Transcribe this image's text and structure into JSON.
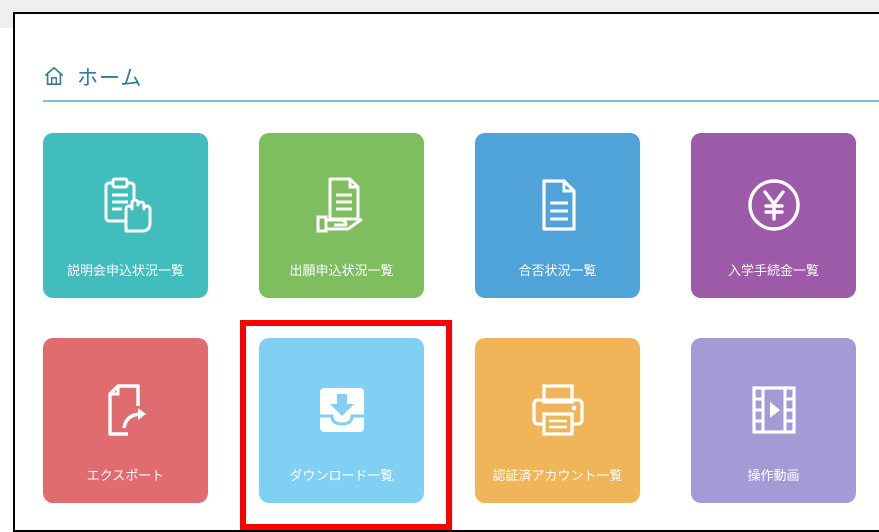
{
  "header": {
    "title": "ホーム",
    "icon": "home-icon"
  },
  "tiles": [
    {
      "label": "説明会申込状況一覧",
      "color": "#41bdbd",
      "icon": "clipboard-hand-icon"
    },
    {
      "label": "出願申込状況一覧",
      "color": "#7fbe5f",
      "icon": "document-hand-icon"
    },
    {
      "label": "合否状況一覧",
      "color": "#4fa3d8",
      "icon": "document-icon"
    },
    {
      "label": "入学手続金一覧",
      "color": "#9c5aa8",
      "icon": "yen-circle-icon"
    },
    {
      "label": "エクスポート",
      "color": "#e06c6f",
      "icon": "export-file-icon"
    },
    {
      "label": "ダウンロード一覧",
      "color": "#80d0f4",
      "icon": "download-tray-icon"
    },
    {
      "label": "認証済アカウント一覧",
      "color": "#f0b558",
      "icon": "printer-icon"
    },
    {
      "label": "操作動画",
      "color": "#a39bd6",
      "icon": "video-film-icon"
    }
  ],
  "highlight_color": "#ff0000"
}
